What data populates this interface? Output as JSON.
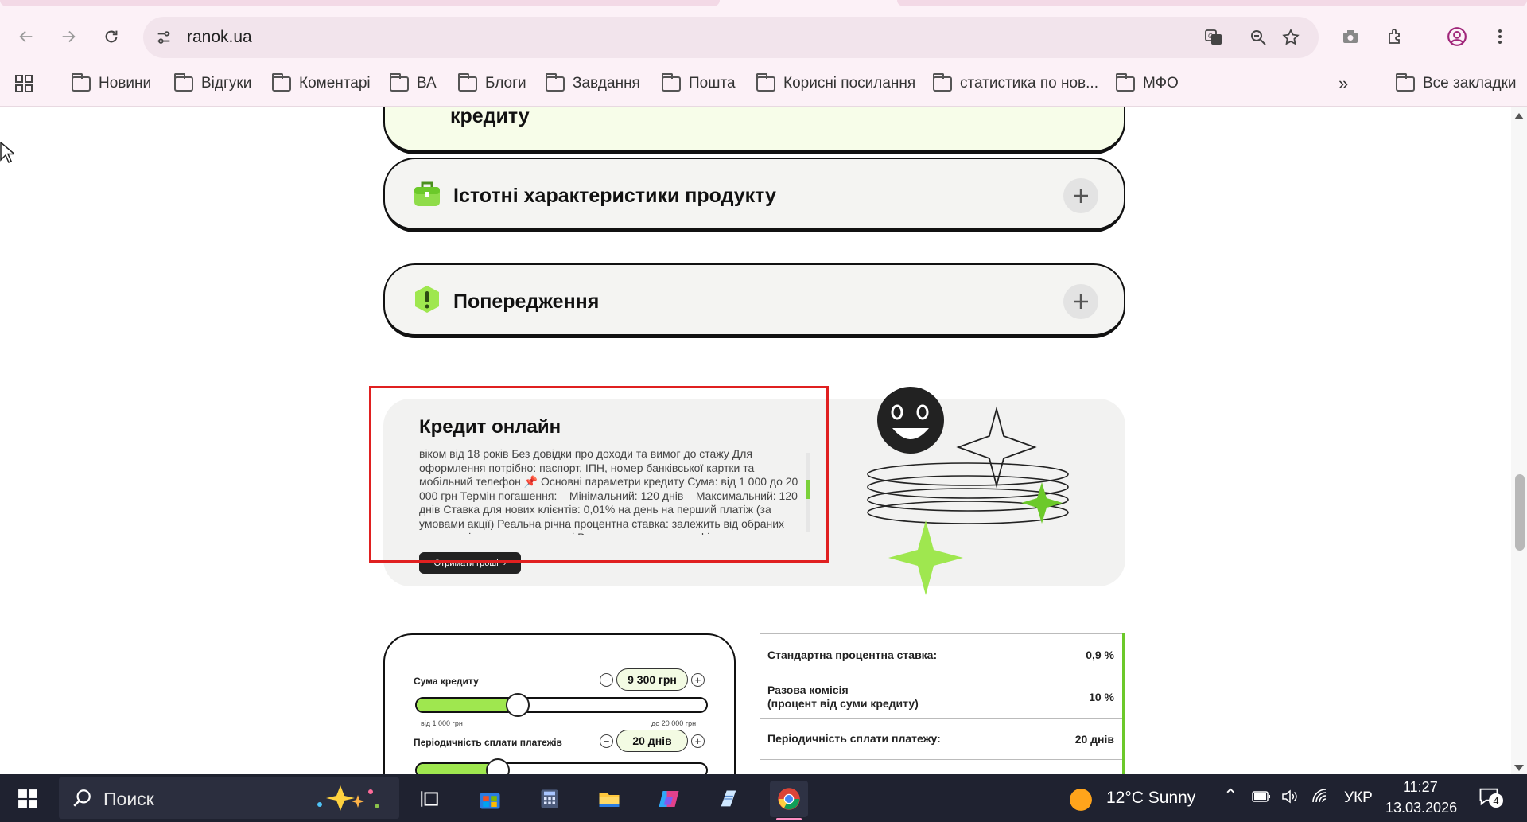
{
  "browser": {
    "url": "ranok.ua",
    "bookmarks": [
      "Новини",
      "Відгуки",
      "Коментарі",
      "ВА",
      "Блоги",
      "Завдання",
      "Пошта",
      "Корисні посилання",
      "статистика по нов...",
      "МФО"
    ],
    "all_bookmarks": "Все закладки"
  },
  "page": {
    "accordion_top_title": "кредиту",
    "accordions": [
      {
        "title": "Істотні характеристики продукту",
        "icon": "briefcase-icon"
      },
      {
        "title": "Попередження",
        "icon": "warning-icon"
      }
    ],
    "credit_card": {
      "title": "Кредит онлайн",
      "description": "віком від 18 років Без довідки про доходи та вимог до стажу Для оформлення потрібно: паспорт, ІПН, номер банківської картки та мобільний телефон 📌 Основні параметри кредиту Сума: від 1 000 до 20 000 грн Термін погашення: – Мінімальний: 120 днів – Максимальний: 120 днів Ставка для нових клієнтів: 0,01% на день на перший платіж (за умовами акції) Реальна річна процентна ставка: залежить від обраних параметрів та умов договору і Вашого кредитного профілю",
      "cta": "Отримати гроші"
    },
    "calculator": {
      "amount_label": "Сума кредиту",
      "amount_value": "9 300 грн",
      "amount_fraction": 0.35,
      "amount_min": "від 1 000 грн",
      "amount_max": "до 20 000 грн",
      "period_label": "Періодичність сплати платежів",
      "period_value": "20 днів",
      "period_fraction": 0.28
    },
    "terms": [
      {
        "label": "Стандартна процентна ставка:",
        "value": "0,9 %"
      },
      {
        "label": "Разова комісія\n(процент від суми кредиту)",
        "value": "10 %"
      },
      {
        "label": "Періодичність сплати платежу:",
        "value": "20 днів"
      }
    ]
  },
  "taskbar": {
    "search_label": "Поиск",
    "weather": "12°C  Sunny",
    "language": "УКР",
    "time": "11:27",
    "date": "13.03.2026",
    "notifications": "4"
  },
  "colors": {
    "accent_green": "#9fe74f",
    "highlight_red": "#e02020",
    "chrome_bg": "#fcf1f7"
  }
}
